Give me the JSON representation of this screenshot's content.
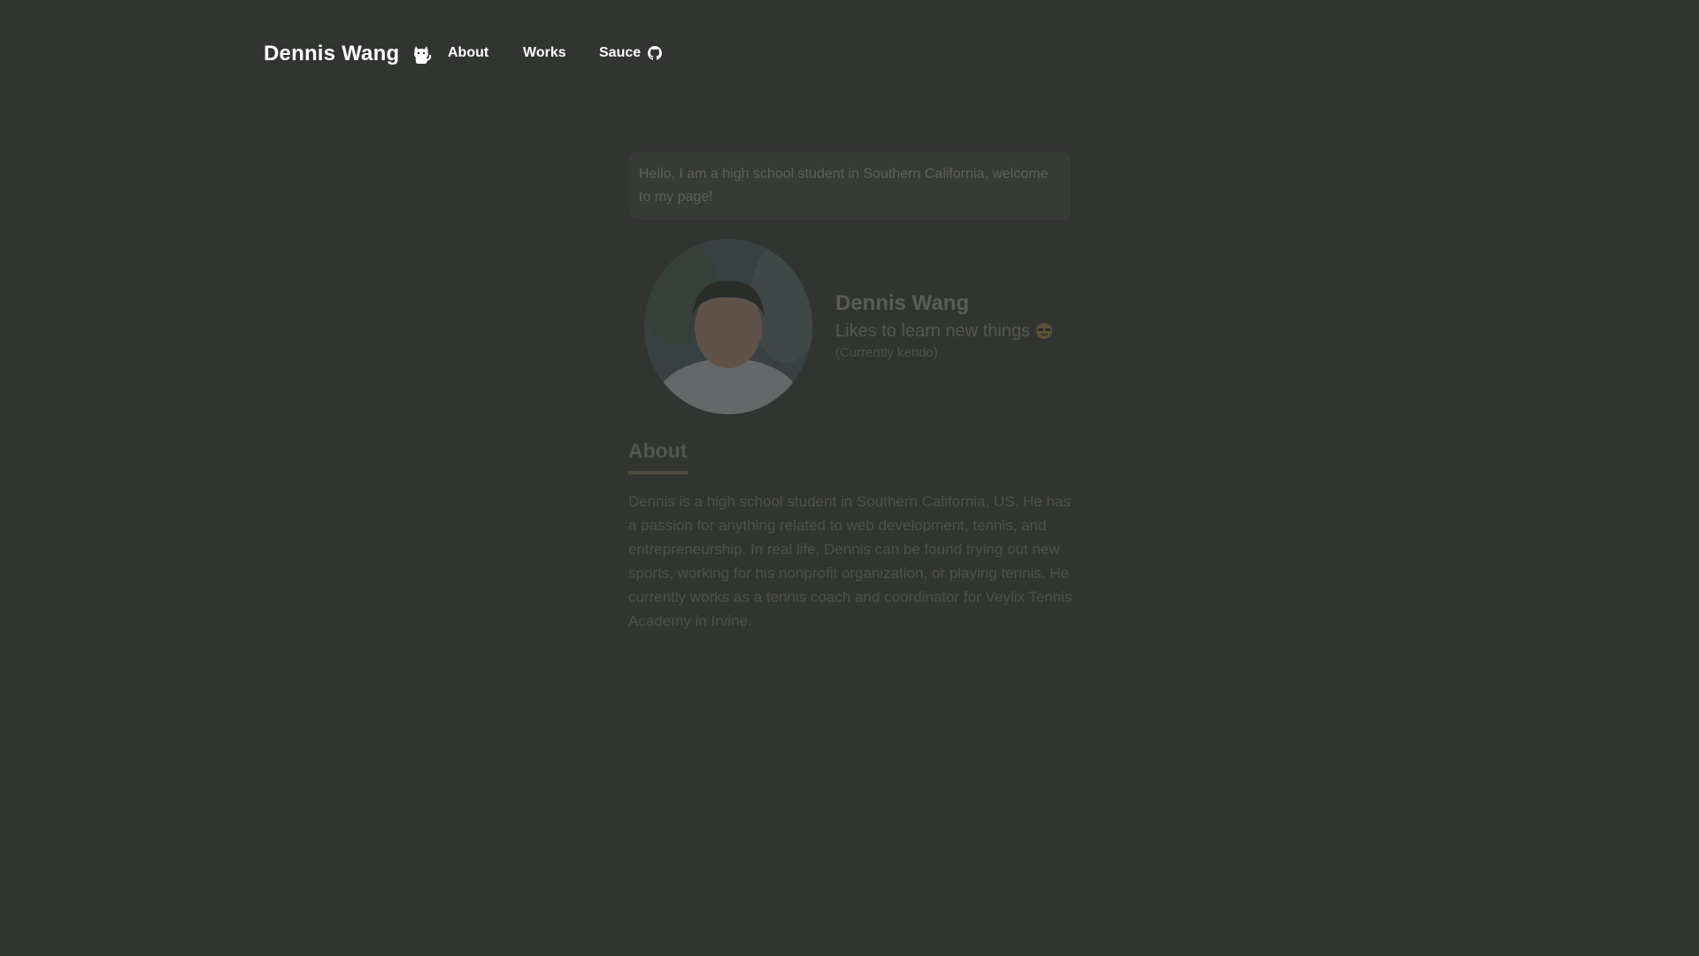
{
  "colors": {
    "background": "#323432",
    "nav_text": "#ffffff",
    "dim_text": "#4e504c"
  },
  "navbar": {
    "brand": {
      "name": "Dennis Wang",
      "icon": "cat-icon"
    },
    "links": [
      {
        "label": "About"
      },
      {
        "label": "Works"
      },
      {
        "label": "Sauce",
        "icon": "github-icon"
      }
    ]
  },
  "main": {
    "greeting": "Hello, I am a high school student in Southern California, welcome to my page!",
    "profile": {
      "name": "Dennis Wang",
      "tagline": "Likes to learn new things",
      "tagline_icon": "sunglasses-emoji-icon",
      "note": "(Currently kendo)"
    },
    "about": {
      "heading": "About",
      "body": "Dennis is a high school student in Southern California, US. He has a passion for anything related to web development, tennis, and entrepreneurship. In real life, Dennis can be found trying out new sports, working for his nonprofit organization, or playing tennis. He currently works as a tennis coach and coordinator for Veylix Tennis Academy in Irvine."
    }
  }
}
